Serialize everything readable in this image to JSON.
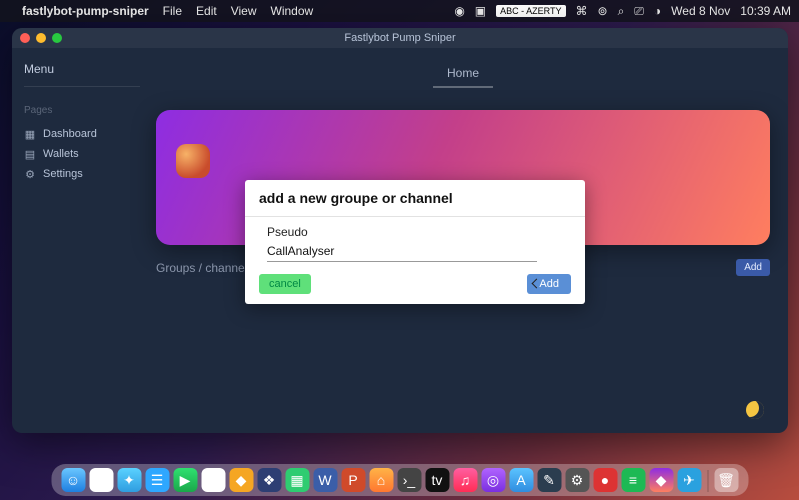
{
  "menubar": {
    "app_name": "fastlybot-pump-sniper",
    "items": [
      "File",
      "Edit",
      "View",
      "Window"
    ],
    "lang_badge": "ABC - AZERTY",
    "date": "Wed 8 Nov",
    "time": "10:39 AM"
  },
  "window": {
    "title": "Fastlybot Pump Sniper"
  },
  "sidebar": {
    "menu_label": "Menu",
    "section_label": "Pages",
    "items": [
      {
        "icon": "dashboard-icon",
        "label": "Dashboard"
      },
      {
        "icon": "wallet-icon",
        "label": "Wallets"
      },
      {
        "icon": "gear-icon",
        "label": "Settings"
      }
    ]
  },
  "main": {
    "tab_home": "Home",
    "groups_label": "Groups / channels",
    "add_label": "Add"
  },
  "modal": {
    "title": "add a new groupe or channel",
    "field_label": "Pseudo",
    "field_value": "CallAnalyser",
    "cancel_label": "cancel",
    "confirm_label": "Add"
  }
}
